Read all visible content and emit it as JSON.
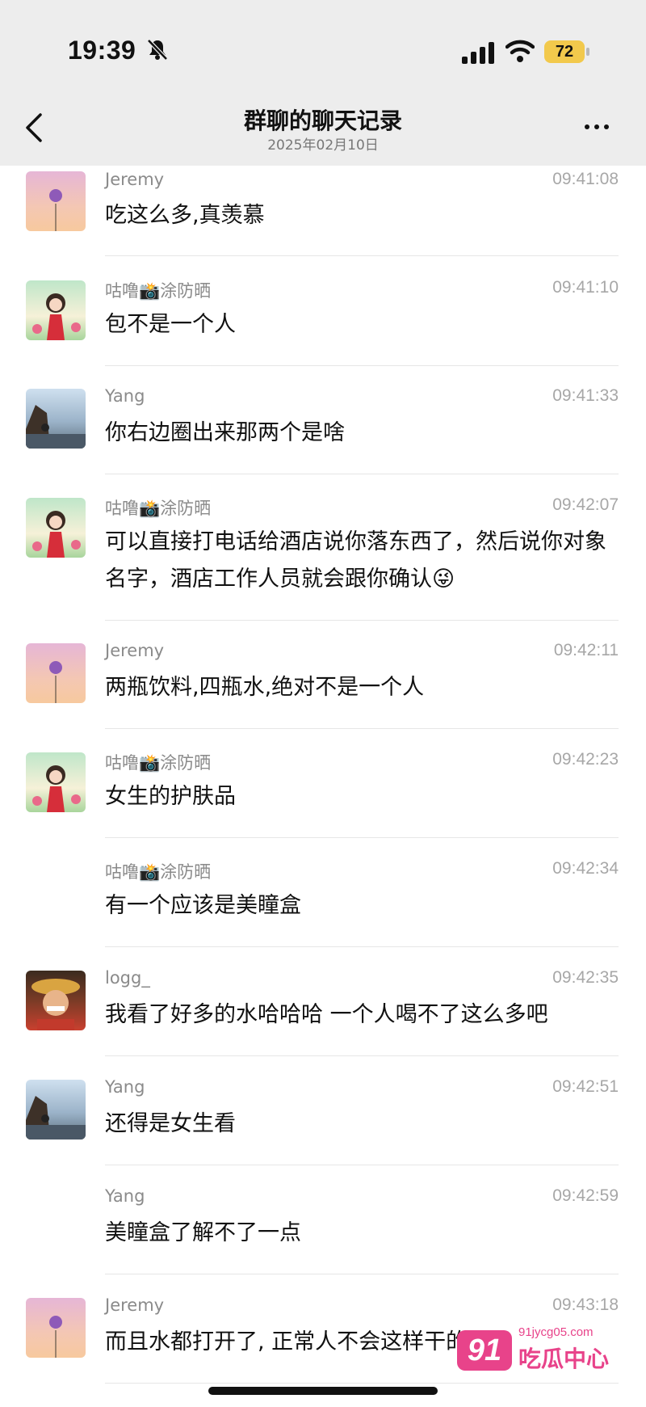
{
  "status_bar": {
    "time": "19:39",
    "battery": "72"
  },
  "header": {
    "title": "群聊的聊天记录",
    "date": "2025年02月10日"
  },
  "messages": [
    {
      "name": "Jeremy",
      "time": "09:41:08",
      "text": "吃这么多,真羡慕",
      "avatar": "jeremy"
    },
    {
      "name": "咕噜📸涂防晒",
      "time": "09:41:10",
      "text": "包不是一个人",
      "avatar": "gulu"
    },
    {
      "name": "Yang",
      "time": "09:41:33",
      "text": "你右边圈出来那两个是啥",
      "avatar": "yang"
    },
    {
      "name": "咕噜📸涂防晒",
      "time": "09:42:07",
      "text": "可以直接打电话给酒店说你落东西了，然后说你对象名字，酒店工作人员就会跟你确认😜",
      "avatar": "gulu"
    },
    {
      "name": "Jeremy",
      "time": "09:42:11",
      "text": "两瓶饮料,四瓶水,绝对不是一个人",
      "avatar": "jeremy"
    },
    {
      "name": "咕噜📸涂防晒",
      "time": "09:42:23",
      "text": "女生的护肤品",
      "avatar": "gulu"
    },
    {
      "name": "咕噜📸涂防晒",
      "time": "09:42:34",
      "text": "有一个应该是美瞳盒",
      "avatar": ""
    },
    {
      "name": "logg_",
      "time": "09:42:35",
      "text": "我看了好多的水哈哈哈 一个人喝不了这么多吧",
      "avatar": "logg"
    },
    {
      "name": "Yang",
      "time": "09:42:51",
      "text": "还得是女生看",
      "avatar": "yang"
    },
    {
      "name": "Yang",
      "time": "09:42:59",
      "text": "美瞳盒了解不了一点",
      "avatar": ""
    },
    {
      "name": "Jeremy",
      "time": "09:43:18",
      "text": "而且水都打开了, 正常人不会这样干的",
      "avatar": "jeremy"
    }
  ],
  "watermark": {
    "badge": "91",
    "url": "91jycg05.com",
    "brand": "吃瓜中心"
  },
  "icons": {
    "back": "chevron-left-icon",
    "more": "more-dots-icon",
    "mute": "bell-slash-icon",
    "signal": "cellular-signal-icon",
    "wifi": "wifi-icon",
    "battery": "battery-icon"
  }
}
